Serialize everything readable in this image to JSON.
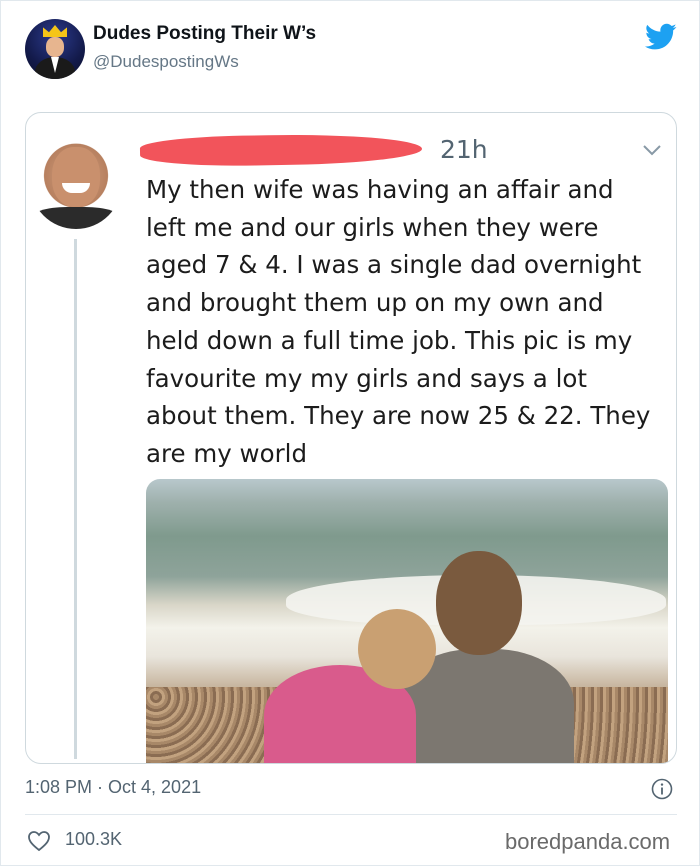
{
  "header": {
    "display_name": "Dudes Posting Their W’s",
    "handle": "@DudespostingWs",
    "avatar_icon": "profile-avatar",
    "brand_icon": "twitter-bird-icon",
    "brand_color": "#1da1f2"
  },
  "embedded_tweet": {
    "time": "21h",
    "chevron_icon": "chevron-down-icon",
    "redaction_color": "#f2545b",
    "text_lines": [
      "My then wife was having an affair and",
      "left me and our girls when they were",
      "aged 7 & 4. I was a single dad overnight",
      "and brought them up on my own and",
      "held down a full time job. This pic is my",
      "favourite my my girls and says a lot",
      "about them. They are now 25 & 22. They",
      "are my world"
    ]
  },
  "footer": {
    "timestamp": "1:08 PM · Oct 4, 2021",
    "info_icon": "info-icon",
    "like_icon": "heart-icon",
    "like_count": "100.3K",
    "watermark": "boredpanda.com"
  }
}
